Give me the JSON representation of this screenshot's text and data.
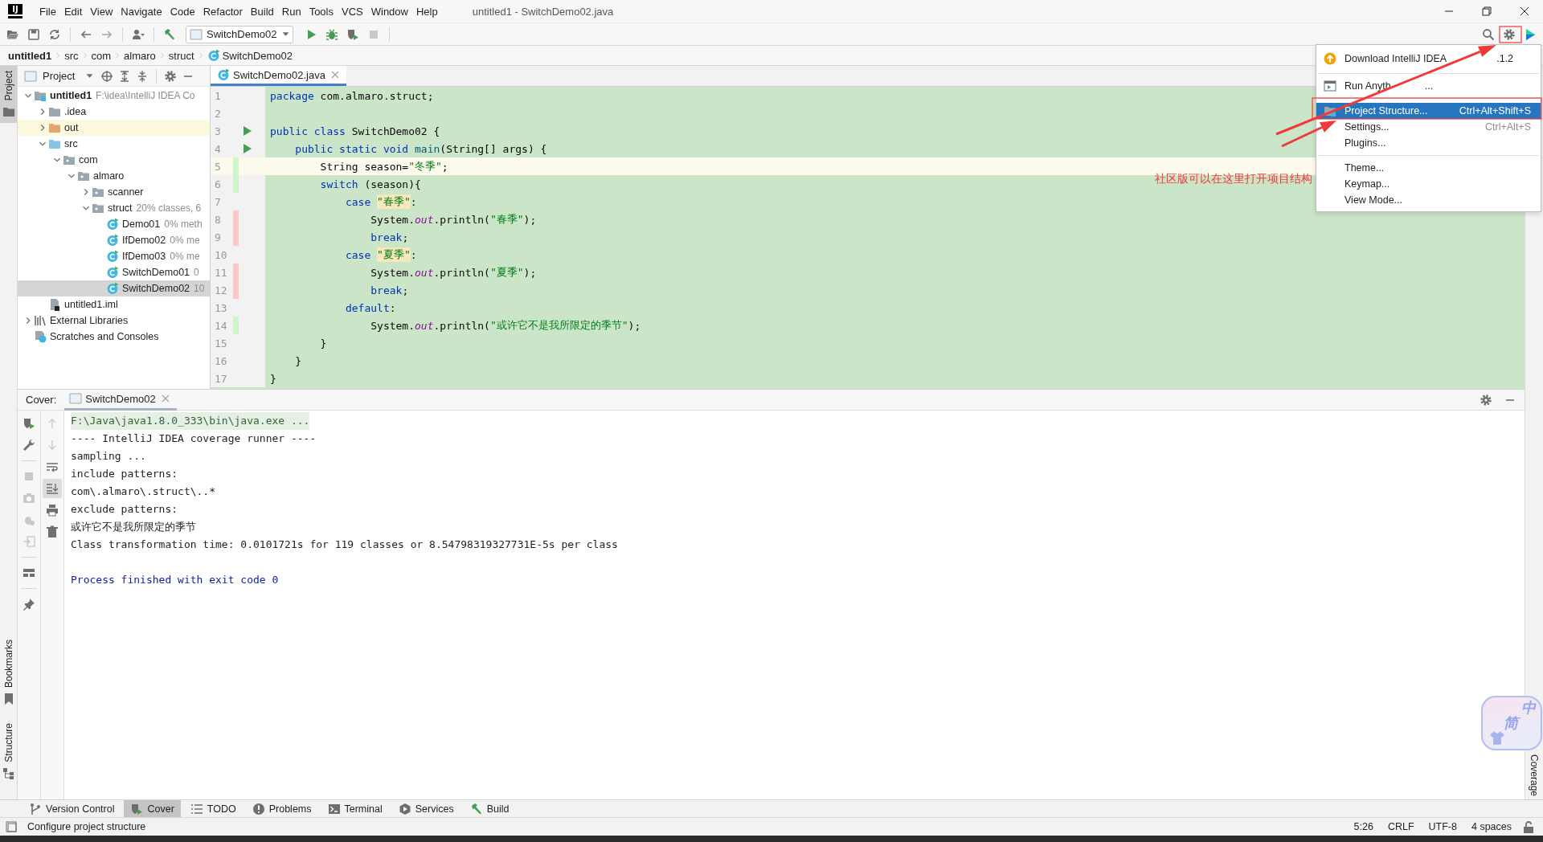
{
  "window": {
    "logo": "IJ",
    "title": "untitled1 - SwitchDemo02.java"
  },
  "menu": [
    "File",
    "Edit",
    "View",
    "Navigate",
    "Code",
    "Refactor",
    "Build",
    "Run",
    "Tools",
    "VCS",
    "Window",
    "Help"
  ],
  "toolbar": {
    "run_config": "SwitchDemo02"
  },
  "breadcrumb": [
    "untitled1",
    "src",
    "com",
    "almaro",
    "struct",
    "SwitchDemo02"
  ],
  "left_stripe": [
    {
      "label": "Project",
      "kind": "project",
      "selected": true
    },
    {
      "label": "Bookmarks",
      "kind": "bookmarks",
      "selected": false
    },
    {
      "label": "Structure",
      "kind": "structure",
      "selected": false
    }
  ],
  "project_panel": {
    "title": "Project",
    "tree": [
      {
        "label": "untitled1",
        "hint": "F:\\idea\\IntelliJ IDEA Co",
        "kind": "module",
        "expanded": true,
        "selected": false,
        "children": [
          {
            "label": ".idea",
            "kind": "folder",
            "expanded": false,
            "selected": false
          },
          {
            "label": "out",
            "kind": "excluded",
            "expanded": false,
            "selected": false
          },
          {
            "label": "src",
            "kind": "source",
            "expanded": true,
            "selected": false,
            "children": [
              {
                "label": "com",
                "kind": "package",
                "expanded": true,
                "selected": false,
                "children": [
                  {
                    "label": "almaro",
                    "kind": "package",
                    "expanded": true,
                    "selected": false,
                    "children": [
                      {
                        "label": "scanner",
                        "kind": "package",
                        "expanded": false,
                        "selected": false
                      },
                      {
                        "label": "struct",
                        "hint": "20% classes, 6",
                        "kind": "package",
                        "expanded": true,
                        "selected": false,
                        "children": [
                          {
                            "label": "Demo01",
                            "hint": "0% meth",
                            "kind": "class",
                            "selected": false
                          },
                          {
                            "label": "IfDemo02",
                            "hint": "0% me",
                            "kind": "class",
                            "selected": false
                          },
                          {
                            "label": "IfDemo03",
                            "hint": "0% me",
                            "kind": "class",
                            "selected": false
                          },
                          {
                            "label": "SwitchDemo01",
                            "hint": "0",
                            "kind": "class",
                            "selected": false
                          },
                          {
                            "label": "SwitchDemo02",
                            "hint": "10",
                            "kind": "class",
                            "selected": true
                          }
                        ]
                      }
                    ]
                  }
                ]
              }
            ]
          },
          {
            "label": "untitled1.iml",
            "kind": "iml",
            "selected": false
          }
        ]
      },
      {
        "label": "External Libraries",
        "kind": "libraries",
        "expanded": false,
        "selected": false
      },
      {
        "label": "Scratches and Consoles",
        "kind": "scratches",
        "selected": false
      }
    ]
  },
  "editor": {
    "tab": {
      "label": "SwitchDemo02.java",
      "selected": true
    },
    "lines": [
      {
        "number": "1",
        "run": false,
        "current": false,
        "tokens": [
          {
            "kind": "keyword",
            "text": "package"
          },
          {
            "kind": "plain",
            "text": " com.almaro.struct;"
          }
        ]
      },
      {
        "number": "2",
        "run": false,
        "current": false
      },
      {
        "number": "3",
        "run": true,
        "current": false,
        "tokens": [
          {
            "kind": "keyword",
            "text": "public class"
          },
          {
            "kind": "plain",
            "text": " SwitchDemo02 {"
          }
        ]
      },
      {
        "number": "4",
        "run": true,
        "current": false,
        "tokens": [
          {
            "kind": "keyword",
            "text": "    public static void"
          },
          {
            "kind": "method",
            "text": " main"
          },
          {
            "kind": "plain",
            "text": "(String[] args) {"
          }
        ]
      },
      {
        "number": "5",
        "run": false,
        "current": true,
        "color": "#ccf6c9",
        "tokens": [
          {
            "kind": "plain",
            "text": "        String season="
          },
          {
            "kind": "string",
            "text": "\"冬季\""
          },
          {
            "kind": "plain",
            "text": ";"
          }
        ]
      },
      {
        "number": "6",
        "run": false,
        "current": false,
        "color": "#ccf6c9",
        "tokens": [
          {
            "kind": "keyword",
            "text": "        switch"
          },
          {
            "kind": "plain",
            "text": " (season){"
          }
        ]
      },
      {
        "number": "7",
        "run": false,
        "current": false,
        "tokens": [
          {
            "kind": "keyword",
            "text": "            case "
          },
          {
            "kind": "match",
            "text": "\"春季\""
          },
          {
            "kind": "plain",
            "text": ":"
          }
        ]
      },
      {
        "number": "8",
        "run": false,
        "current": false,
        "color": "#fcc7c7",
        "tokens": [
          {
            "kind": "plain",
            "text": "                System."
          },
          {
            "kind": "field",
            "text": "out"
          },
          {
            "kind": "plain",
            "text": ".println("
          },
          {
            "kind": "string",
            "text": "\"春季\""
          },
          {
            "kind": "plain",
            "text": ");"
          }
        ]
      },
      {
        "number": "9",
        "run": false,
        "current": false,
        "color": "#fcc7c7",
        "tokens": [
          {
            "kind": "keyword",
            "text": "                break"
          },
          {
            "kind": "plain",
            "text": ";"
          }
        ]
      },
      {
        "number": "10",
        "run": false,
        "current": false,
        "tokens": [
          {
            "kind": "keyword",
            "text": "            case "
          },
          {
            "kind": "match",
            "text": "\"夏季\""
          },
          {
            "kind": "plain",
            "text": ":"
          }
        ]
      },
      {
        "number": "11",
        "run": false,
        "current": false,
        "color": "#fcc7c7",
        "tokens": [
          {
            "kind": "plain",
            "text": "                System."
          },
          {
            "kind": "field",
            "text": "out"
          },
          {
            "kind": "plain",
            "text": ".println("
          },
          {
            "kind": "string",
            "text": "\"夏季\""
          },
          {
            "kind": "plain",
            "text": ");"
          }
        ]
      },
      {
        "number": "12",
        "run": false,
        "current": false,
        "color": "#fcc7c7",
        "tokens": [
          {
            "kind": "keyword",
            "text": "                break"
          },
          {
            "kind": "plain",
            "text": ";"
          }
        ]
      },
      {
        "number": "13",
        "run": false,
        "current": false,
        "tokens": [
          {
            "kind": "keyword",
            "text": "            default"
          },
          {
            "kind": "plain",
            "text": ":"
          }
        ]
      },
      {
        "number": "14",
        "run": false,
        "current": false,
        "color": "#ccf6c9",
        "tokens": [
          {
            "kind": "plain",
            "text": "                System."
          },
          {
            "kind": "field",
            "text": "out"
          },
          {
            "kind": "plain",
            "text": ".println("
          },
          {
            "kind": "string",
            "text": "\"或许它不是我所限定的季节\""
          },
          {
            "kind": "plain",
            "text": ");"
          }
        ]
      },
      {
        "number": "15",
        "run": false,
        "current": false,
        "tokens": [
          {
            "kind": "plain",
            "text": "        }"
          }
        ]
      },
      {
        "number": "16",
        "run": false,
        "current": false,
        "tokens": [
          {
            "kind": "plain",
            "text": "    }"
          }
        ]
      },
      {
        "number": "17",
        "run": false,
        "current": false,
        "tokens": [
          {
            "kind": "plain",
            "text": "}"
          }
        ]
      }
    ]
  },
  "cover_panel": {
    "label": "Cover:",
    "tab": "SwitchDemo02",
    "console": [
      {
        "kind": "command",
        "text": "F:\\Java\\java1.8.0_333\\bin\\java.exe ..."
      },
      {
        "kind": "output",
        "text": "---- IntelliJ IDEA coverage runner ----"
      },
      {
        "kind": "output",
        "text": "sampling ..."
      },
      {
        "kind": "output",
        "text": "include patterns:"
      },
      {
        "kind": "output",
        "text": "com\\.almaro\\.struct\\..*"
      },
      {
        "kind": "output",
        "text": "exclude patterns:"
      },
      {
        "kind": "output",
        "text": "或许它不是我所限定的季节"
      },
      {
        "kind": "output",
        "text": "Class transformation time: 0.0101721s for 119 classes or 8.54798319327731E-5s per class"
      },
      {
        "kind": "exit",
        "text": "Process finished with exit code 0"
      }
    ]
  },
  "right_stripe": [
    {
      "label": "Coverage"
    }
  ],
  "tool_tabs": [
    {
      "label": "Version Control",
      "kind": "vcs",
      "selected": false
    },
    {
      "label": "Cover",
      "kind": "cover",
      "selected": true
    },
    {
      "label": "TODO",
      "kind": "todo",
      "selected": false
    },
    {
      "label": "Problems",
      "kind": "problems",
      "selected": false
    },
    {
      "label": "Terminal",
      "kind": "terminal",
      "selected": false
    },
    {
      "label": "Services",
      "kind": "services",
      "selected": false
    },
    {
      "label": "Build",
      "kind": "build",
      "selected": false
    }
  ],
  "status_bar": {
    "message": "Configure project structure",
    "items": [
      "5:26",
      "CRLF",
      "UTF-8",
      "4 spaces"
    ]
  },
  "popup_menu": {
    "items": [
      {
        "kind": "update",
        "label": "Download IntelliJ IDEA",
        "label_end": ".1.2",
        "selected": false
      },
      {
        "kind": "separator"
      },
      {
        "kind": "run",
        "label": "Run Anyth",
        "label_end": "...",
        "selected": false
      },
      {
        "kind": "separator"
      },
      {
        "kind": "structure",
        "label": "Project Structure...",
        "shortcut": "Ctrl+Alt+Shift+S",
        "selected": true
      },
      {
        "kind": "plain",
        "label": "Settings...",
        "shortcut": "Ctrl+Alt+S",
        "selected": false
      },
      {
        "kind": "plain",
        "label": "Plugins...",
        "selected": false
      },
      {
        "kind": "separator"
      },
      {
        "kind": "plain",
        "label": "Theme...",
        "selected": false
      },
      {
        "kind": "plain",
        "label": "Keymap...",
        "selected": false
      },
      {
        "kind": "plain",
        "label": "View Mode...",
        "selected": false
      }
    ]
  },
  "annotation": {
    "text": "社区版可以在这里打开项目结构"
  },
  "ime_widget": {
    "chars": [
      "中",
      "简"
    ]
  }
}
